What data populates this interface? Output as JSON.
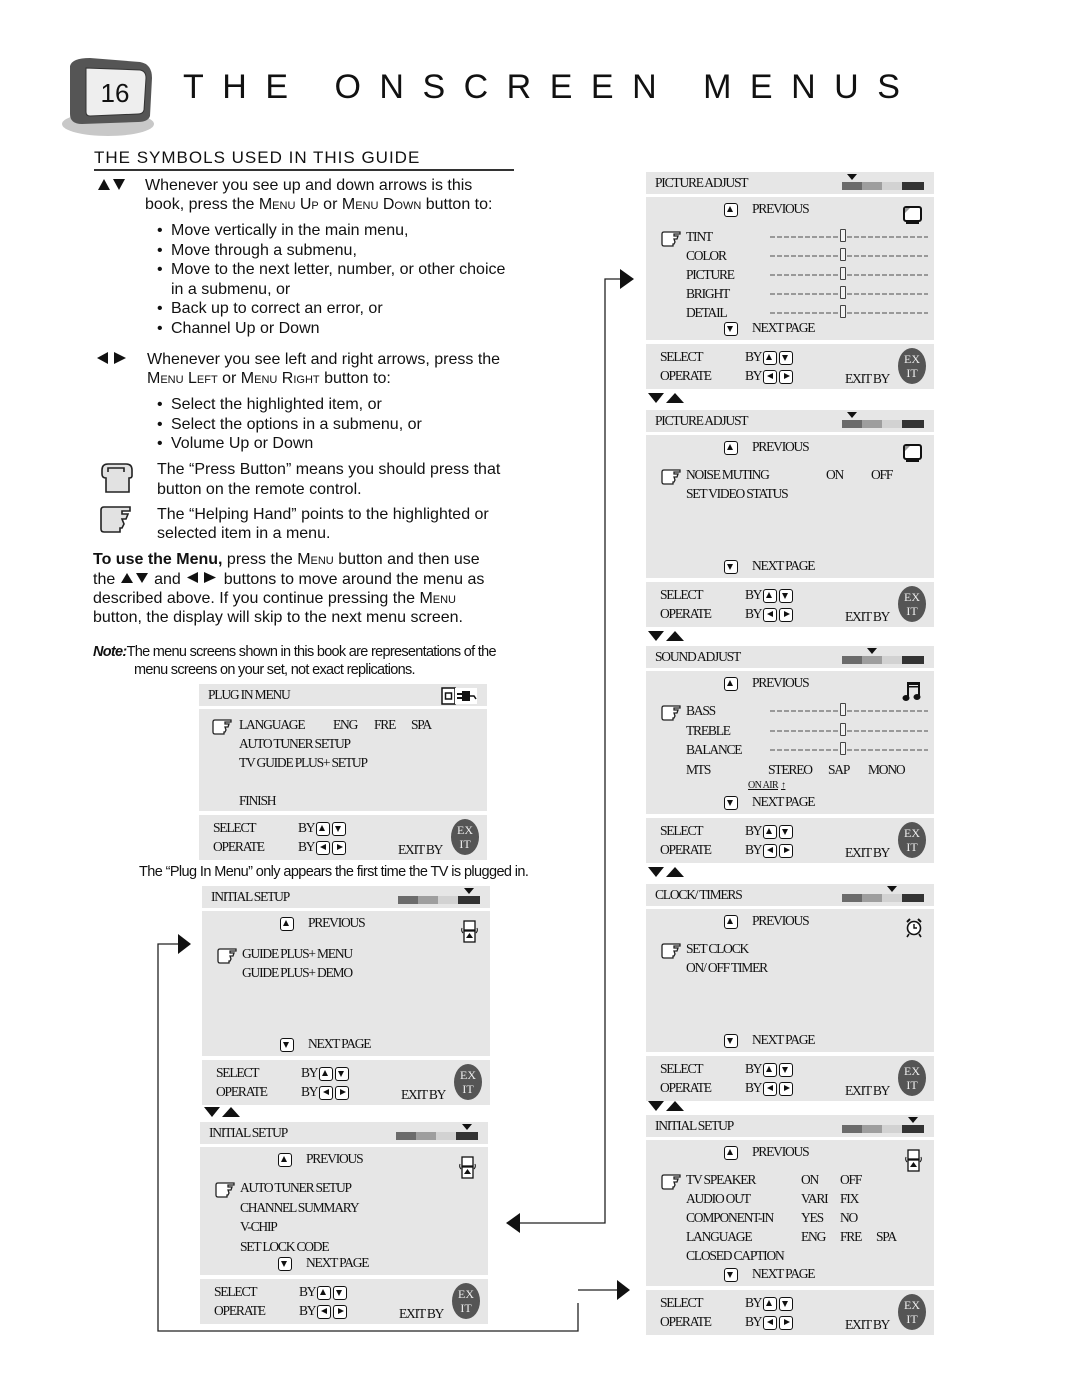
{
  "header": {
    "page_number": "16",
    "title": "THE ONSCREEN MENUS",
    "section_title": "THE SYMBOLS USED IN THIS GUIDE"
  },
  "symbols": {
    "up_down": {
      "icon": "up-down-arrows-icon",
      "intro_line1": "Whenever you see up and down arrows is this",
      "intro_line2_a": "book, press the ",
      "intro_line2_b": "Menu Up",
      "intro_line2_c": " or ",
      "intro_line2_d": "Menu Down",
      "intro_line2_e": " button to:",
      "bullets": [
        "Move vertically in the main menu,",
        "Move through a submenu,",
        "Move to the next letter, number, or other choice",
        "Back up to correct an error, or",
        "Channel Up or Down"
      ],
      "bullet3_cont": "in a submenu, or"
    },
    "left_right": {
      "icon": "left-right-arrows-icon",
      "intro_line1": "Whenever you see left and right arrows, press the",
      "intro_line2_a": "Menu Left",
      "intro_line2_b": " or ",
      "intro_line2_c": "Menu Right",
      "intro_line2_d": " button to:",
      "bullets": [
        "Select the highlighted item, or",
        "Select the options in a submenu, or",
        "Volume Up or Down"
      ]
    },
    "press_button": {
      "icon": "press-button-icon",
      "line1": "The “Press Button” means you should press that",
      "line2": "button on the remote control."
    },
    "helping_hand": {
      "icon": "helping-hand-icon",
      "line1": "The “Helping Hand” points to the highlighted or",
      "line2": "selected item in a menu."
    }
  },
  "usage": {
    "bold_lead": "To use the Menu,",
    "l1": " press the ",
    "menu_word": "Menu",
    "l1b": " button and then use",
    "l2a": "the ",
    "l2b": " and ",
    "l2c": " buttons to move around the menu as",
    "l3": "described above.  If you continue pressing the ",
    "l4": "button, the display will skip to the next menu screen."
  },
  "note": {
    "label": "Note:",
    "line1": "The menu screens shown in this book are  representations of the",
    "line2": "menu screens on your set, not exact replications."
  },
  "plug_in_caption": "The “Plug In Menu” only appears the first time the TV is plugged in.",
  "common": {
    "previous": "PREVIOUS",
    "next_page": "NEXT PAGE",
    "select": "SELECT",
    "operate": "OPERATE",
    "by": "BY",
    "exit_by": "EXIT BY",
    "exit_top": "EX",
    "exit_bottom": "IT"
  },
  "menus": {
    "plug_in": {
      "title": "PLUG IN MENU",
      "icon": "plug-icon",
      "items": [
        {
          "label": "LANGUAGE",
          "options": [
            "ENG",
            "FRE",
            "SPA"
          ]
        },
        {
          "label": "AUTO TUNER SETUP"
        },
        {
          "label": "TV GUIDE PLUS+ SETUP"
        },
        {
          "label": "FINISH"
        }
      ]
    },
    "initial_setup_1": {
      "title": "INITIAL SETUP",
      "icon": "setup-icon",
      "active_tab": 4,
      "items": [
        {
          "label": "GUIDE PLUS+ MENU"
        },
        {
          "label": "GUIDE PLUS+ DEMO"
        }
      ]
    },
    "initial_setup_2": {
      "title": "INITIAL SETUP",
      "icon": "setup-icon",
      "active_tab": 4,
      "items": [
        {
          "label": "AUTO TUNER SETUP"
        },
        {
          "label": "CHANNEL SUMMARY"
        },
        {
          "label": "V-CHIP"
        },
        {
          "label": "SET LOCK CODE"
        }
      ]
    },
    "picture_adjust_1": {
      "title": "PICTURE ADJUST",
      "icon": "tv-screen-icon",
      "active_tab": 1,
      "sliders": [
        {
          "label": "TINT",
          "value": 0.5
        },
        {
          "label": "COLOR",
          "value": 0.5
        },
        {
          "label": "PICTURE",
          "value": 0.5
        },
        {
          "label": "BRIGHT",
          "value": 0.5
        },
        {
          "label": "DETAIL",
          "value": 0.5
        }
      ]
    },
    "picture_adjust_2": {
      "title": "PICTURE ADJUST",
      "icon": "tv-screen-icon",
      "active_tab": 1,
      "items": [
        {
          "label": "NOISE MUTING",
          "options": [
            "ON",
            "OFF"
          ]
        },
        {
          "label": "SET VIDEO STATUS"
        }
      ]
    },
    "sound_adjust": {
      "title": "SOUND ADJUST",
      "icon": "music-note-icon",
      "active_tab": 2,
      "sliders": [
        {
          "label": "BASS",
          "value": 0.5
        },
        {
          "label": "TREBLE",
          "value": 0.5
        },
        {
          "label": "BALANCE",
          "value": 0.5
        }
      ],
      "mts": {
        "label": "MTS",
        "options": [
          "STEREO",
          "SAP",
          "MONO"
        ],
        "on_air": "ON AIR"
      }
    },
    "clock_timers": {
      "title": "CLOCK/ TIMERS",
      "icon": "alarm-clock-icon",
      "active_tab": 3,
      "items": [
        {
          "label": "SET CLOCK"
        },
        {
          "label": "ON/ OFF TIMER"
        }
      ]
    },
    "initial_setup_3": {
      "title": "INITIAL SETUP",
      "icon": "setup-icon",
      "active_tab": 4,
      "items": [
        {
          "label": "TV SPEAKER",
          "options": [
            "ON",
            "OFF"
          ]
        },
        {
          "label": "AUDIO OUT",
          "options": [
            "VARI",
            "FIX"
          ]
        },
        {
          "label": "COMPONENT-IN",
          "options": [
            "YES",
            "NO"
          ]
        },
        {
          "label": "LANGUAGE",
          "options": [
            "ENG",
            "FRE",
            "SPA"
          ]
        },
        {
          "label": "CLOSED CAPTION"
        }
      ]
    }
  },
  "colors": {
    "menu_bg": "#e6e6e6",
    "tab_1": "#6b6b6b",
    "tab_2": "#9e9e9e",
    "tab_3": "#d2d2d2",
    "tab_4": "#333333",
    "exit_badge": "#555555"
  }
}
